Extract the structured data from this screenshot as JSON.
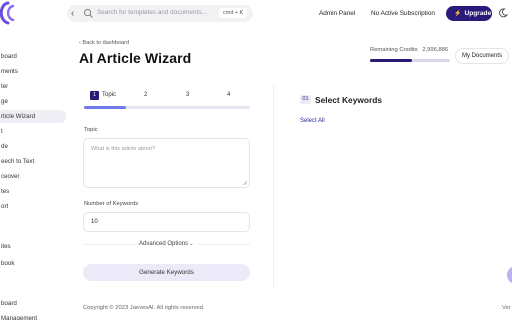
{
  "search": {
    "placeholder": "Search for templates and documents...",
    "shortcut": "cmd + K"
  },
  "header": {
    "admin_label": "Admin Panel",
    "subscription_label": "No Active Subscription",
    "upgrade_label": "Upgrade"
  },
  "sidebar": {
    "items": [
      {
        "label": "board"
      },
      {
        "label": "ments"
      },
      {
        "label": "ter"
      },
      {
        "label": "ge"
      },
      {
        "label": "rticle Wizard"
      },
      {
        "label": "t"
      },
      {
        "label": "de"
      },
      {
        "label": "eech to Text"
      },
      {
        "label": "ceover"
      },
      {
        "label": "tes"
      },
      {
        "label": "ort"
      },
      {
        "label": "ites"
      },
      {
        "label": "book"
      },
      {
        "label": "board"
      },
      {
        "label": "Management"
      }
    ]
  },
  "page": {
    "back_label": "Back to dashboard",
    "title": "AI Article Wizard",
    "credits_label": "Remaining Credits",
    "credits_value": "2,996,886",
    "credits_fraction": 0.52,
    "my_documents_label": "My Documents"
  },
  "wizard": {
    "steps": [
      {
        "num": "1",
        "label": "Topic"
      },
      {
        "label": "2"
      },
      {
        "label": "3"
      },
      {
        "label": "4"
      }
    ],
    "progress_fraction": 0.25,
    "topic_label": "Topic",
    "topic_placeholder": "What is this article about?",
    "keywords_label": "Number of Keywords",
    "keywords_value": "10",
    "advanced_label": "Advanced Options",
    "generate_label": "Generate Keywords"
  },
  "keywords_panel": {
    "num": "01",
    "title": "Select Keywords",
    "select_all_label": "Select All"
  },
  "footer": {
    "copyright": "Copyright © 2023 JaevesAI. All rights reserved.",
    "version": "Ver"
  },
  "colors": {
    "accent": "#2a1a7a",
    "progress": "#6f7be8",
    "button_bg": "#eceaf8"
  }
}
